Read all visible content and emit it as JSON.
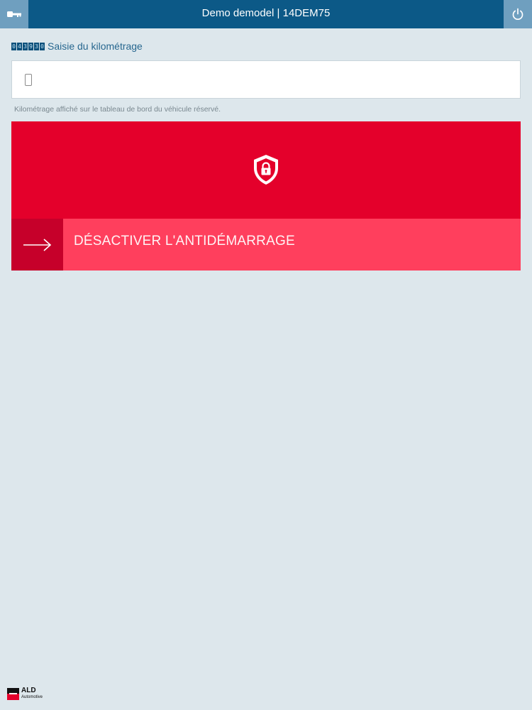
{
  "header": {
    "title": "Demo demodel | 14DEM75",
    "left_icon": "key-icon",
    "right_icon": "power-icon"
  },
  "mileage": {
    "odometer_digits": [
      "0",
      "4",
      "3",
      "9",
      "3",
      "0"
    ],
    "label": "Saisie du kilométrage",
    "input_value": "",
    "input_icon": "phone-icon",
    "hint": "Kilométrage affiché sur le tableau de bord du véhicule réservé."
  },
  "immobilizer": {
    "icon": "shield-lock-icon",
    "action_icon": "arrow-right-icon",
    "action_label": "DÉSACTIVER L'ANTIDÉMARRAGE"
  },
  "footer": {
    "brand": "ALD",
    "brand_sub": "Automotive"
  },
  "colors": {
    "header_bg": "#0c5987",
    "header_button_bg": "#6f9fbf",
    "page_bg": "#dde7ec",
    "red_panel": "#e4002b",
    "action_bar": "#ff3f5d",
    "action_arrow_box": "#c6002a"
  }
}
